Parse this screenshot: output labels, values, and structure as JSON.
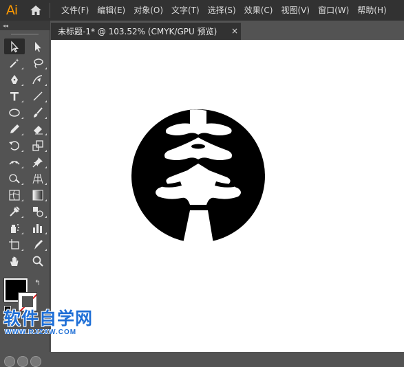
{
  "app": {
    "logo": "Ai"
  },
  "menu": [
    "文件(F)",
    "编辑(E)",
    "对象(O)",
    "文字(T)",
    "选择(S)",
    "效果(C)",
    "视图(V)",
    "窗口(W)",
    "帮助(H)"
  ],
  "document_tab": {
    "title": "未标题-1* @ 103.52% (CMYK/GPU 预览)",
    "close": "×"
  },
  "toolbar": {
    "collapse": "◂◂",
    "tools": [
      "selection-tool",
      "direct-selection-tool",
      "magic-wand-tool",
      "lasso-tool",
      "pen-tool",
      "curvature-tool",
      "type-tool",
      "line-segment-tool",
      "ellipse-tool",
      "paintbrush-tool",
      "pencil-tool",
      "eraser-tool",
      "rotate-tool",
      "scale-tool",
      "puppet-warp-tool",
      "pin-tool",
      "shape-builder-tool",
      "perspective-grid-tool",
      "mesh-tool",
      "gradient-tool",
      "eyedropper-tool",
      "blend-tool",
      "symbol-sprayer-tool",
      "column-graph-tool",
      "artboard-tool",
      "slice-tool",
      "hand-tool",
      "zoom-tool"
    ],
    "swap_glyph": "↰",
    "colors": {
      "fill": "#000000",
      "stroke": "none"
    }
  },
  "watermark": {
    "cn": "软件自学网",
    "url": "WWW.RJZXW.COM"
  },
  "theme": {
    "accent": "#ff9a00",
    "menubar": "#323232",
    "panel": "#535353",
    "canvas": "#ffffff",
    "watermark": "#1f6fd6"
  }
}
